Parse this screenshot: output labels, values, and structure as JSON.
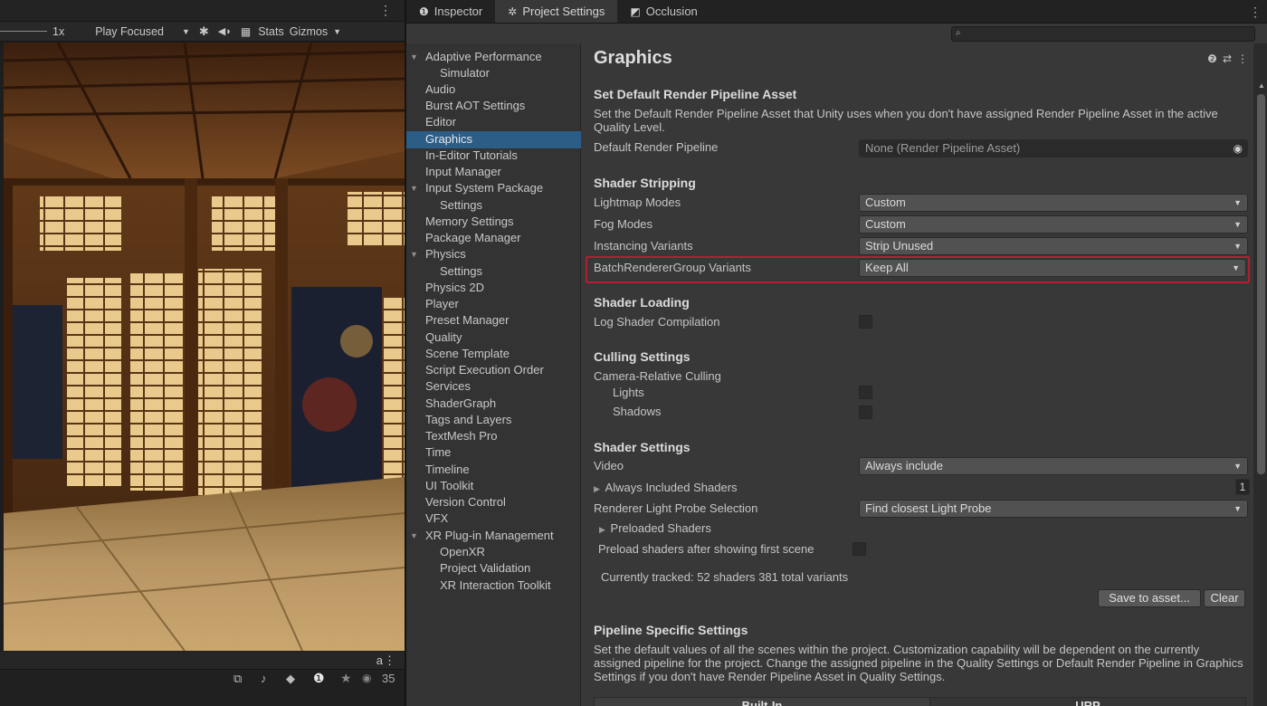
{
  "game": {
    "menu_glyph": "⋮",
    "toolbar": {
      "scale_label": "1x",
      "play_mode": "Play Focused",
      "stats_label": "Stats",
      "gizmos_label": "Gizmos"
    },
    "status": {
      "lock_glyph": "a",
      "menu_glyph": "⋮",
      "visibility_count": "35"
    }
  },
  "tabs": [
    {
      "label": "Inspector",
      "icon": "info-icon"
    },
    {
      "label": "Project Settings",
      "icon": "gear-icon"
    },
    {
      "label": "Occlusion",
      "icon": "occlusion-icon"
    }
  ],
  "tab_menu_glyph": "⋮",
  "nav": {
    "items": [
      "Adaptive Performance",
      "Simulator",
      "Audio",
      "Burst AOT Settings",
      "Editor",
      "Graphics",
      "In-Editor Tutorials",
      "Input Manager",
      "Input System Package",
      "Settings",
      "Memory Settings",
      "Package Manager",
      "Physics",
      "Settings",
      "Physics 2D",
      "Player",
      "Preset Manager",
      "Quality",
      "Scene Template",
      "Script Execution Order",
      "Services",
      "ShaderGraph",
      "Tags and Layers",
      "TextMesh Pro",
      "Time",
      "Timeline",
      "UI Toolkit",
      "Version Control",
      "VFX",
      "XR Plug-in Management",
      "OpenXR",
      "Project Validation",
      "XR Interaction Toolkit"
    ],
    "selected": "Graphics"
  },
  "graphics": {
    "title": "Graphics",
    "default_pipeline": {
      "heading": "Set Default Render Pipeline Asset",
      "description": "Set the Default Render Pipeline Asset that Unity uses when you don't have assigned Render Pipeline Asset in the active Quality Level.",
      "label": "Default Render Pipeline",
      "value": "None (Render Pipeline Asset)"
    },
    "shader_stripping": {
      "heading": "Shader Stripping",
      "lightmap_label": "Lightmap Modes",
      "lightmap_value": "Custom",
      "fog_label": "Fog Modes",
      "fog_value": "Custom",
      "instancing_label": "Instancing Variants",
      "instancing_value": "Strip Unused",
      "brg_label": "BatchRendererGroup Variants",
      "brg_value": "Keep All"
    },
    "shader_loading": {
      "heading": "Shader Loading",
      "log_label": "Log Shader Compilation",
      "log_checked": false
    },
    "culling": {
      "heading": "Culling Settings",
      "camera_relative_label": "Camera-Relative Culling",
      "lights_label": "Lights",
      "shadows_label": "Shadows"
    },
    "shader_settings": {
      "heading": "Shader Settings",
      "video_label": "Video",
      "video_value": "Always include",
      "always_included_label": "Always Included Shaders",
      "always_included_count": "1",
      "probe_label": "Renderer Light Probe Selection",
      "probe_value": "Find closest Light Probe",
      "preloaded_label": "Preloaded Shaders",
      "preload_after_label": "Preload shaders after showing first scene",
      "tracked_text": "Currently tracked: 52 shaders 381 total variants",
      "save_button": "Save to asset...",
      "clear_button": "Clear"
    },
    "pipeline_specific": {
      "heading": "Pipeline Specific Settings",
      "description": "Set the default values of all the scenes within the project. Customization capability will be dependent on the currently assigned pipeline for the project. Change the assigned pipeline in the Quality Settings or Default Render Pipeline in Graphics Settings if you don't have Render Pipeline Asset in Quality Settings.",
      "tab_builtin": "Built-In",
      "tab_urp": "URP"
    }
  },
  "colors": {
    "selection": "#2c5d87",
    "highlight_border": "#b21f32"
  }
}
